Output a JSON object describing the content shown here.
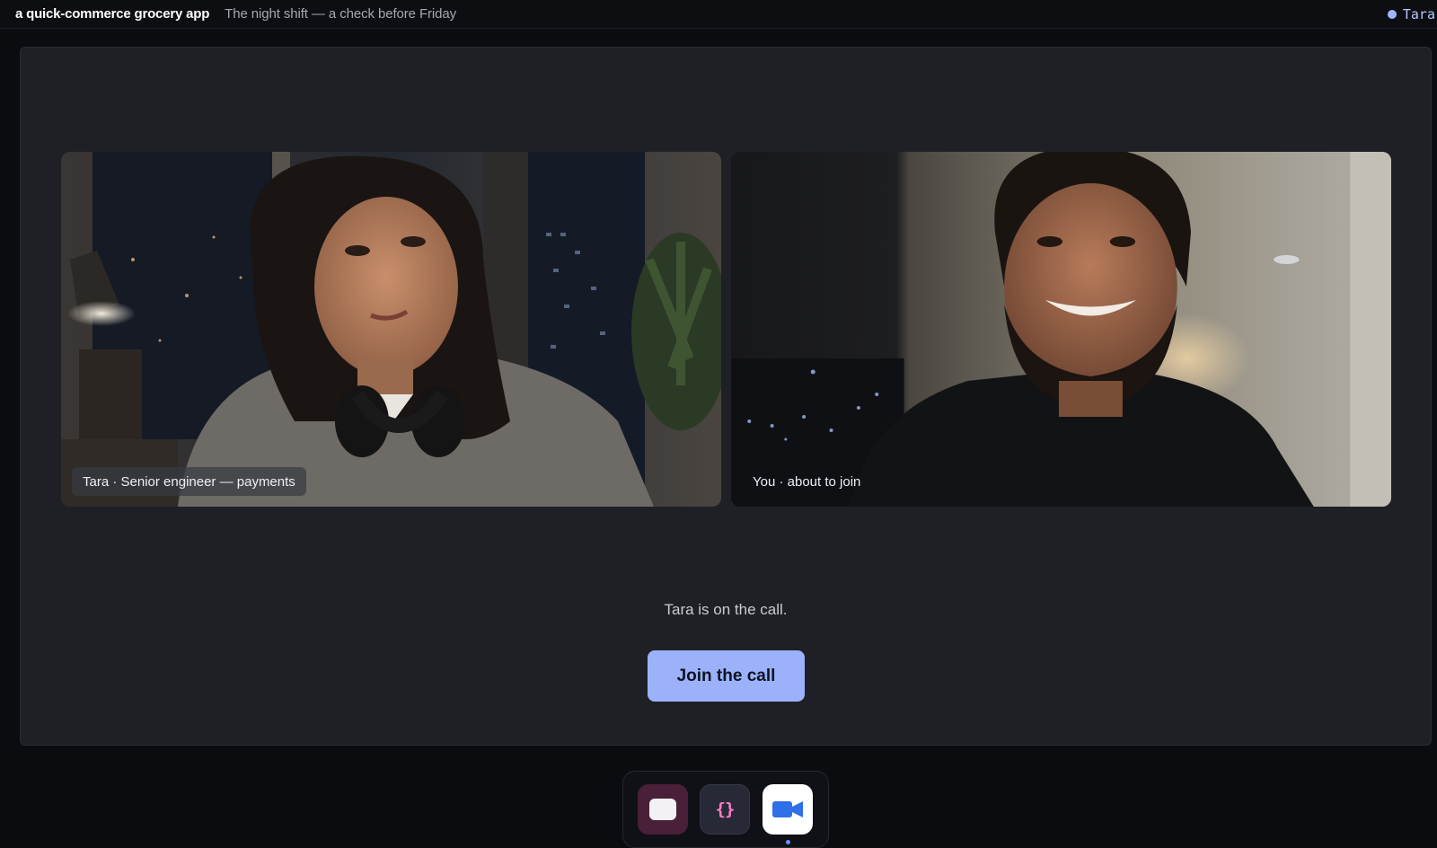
{
  "topbar": {
    "app_title": "a quick-commerce grocery app",
    "session_title": "The night shift — a check before Friday",
    "presence_name": "Tara"
  },
  "call": {
    "participants": [
      {
        "caption": "Tara · Senior engineer — payments"
      },
      {
        "caption": "You · about to join"
      }
    ],
    "status": "Tara is on the call.",
    "join_label": "Join the call"
  },
  "dock": {
    "apps": [
      {
        "icon": "chat-app-icon"
      },
      {
        "icon": "code-editor-icon",
        "glyph": "{}"
      },
      {
        "icon": "video-call-icon",
        "active": true
      }
    ]
  },
  "colors": {
    "accent": "#9bb2fb",
    "presence": "#9fb6ff",
    "code_glyph": "#ff7ac8"
  }
}
